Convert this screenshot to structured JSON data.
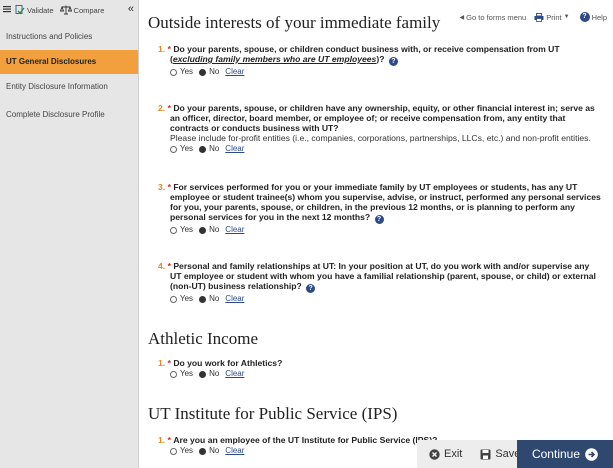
{
  "toolbar": {
    "validate_label": "Validate",
    "compare_label": "Compare",
    "collapse_glyph": "«"
  },
  "sidebar": {
    "items": [
      {
        "label": "Instructions and Policies"
      },
      {
        "label": "UT General Disclosures"
      },
      {
        "label": "Entity Disclosure Information"
      },
      {
        "label": "Complete Disclosure Profile"
      }
    ]
  },
  "header_links": {
    "back": "Go to forms menu",
    "print": "Print",
    "help": "Help"
  },
  "sections": {
    "outside": {
      "title": "Outside interests of your immediate family",
      "q1": {
        "num": "1.",
        "text_a": "Do your parents, spouse, or children conduct business with, or receive compensation from UT",
        "paren_open": "(",
        "emph": "excluding family members who are UT employees",
        "paren_close": ")?"
      },
      "q2": {
        "num": "2.",
        "text": "Do your parents, spouse, or children have any ownership, equity, or other financial interest in; serve as an officer, director, board member, or employee of; or receive compensation from, any entity that contracts or conducts business with UT?",
        "note": "Please include for-profit entities (i.e., companies, corporations, partnerships, LLCs, etc.) and non-profit entities."
      },
      "q3": {
        "num": "3.",
        "text": "For services performed for you or your immediate family by UT employees or students, has any UT employee or student trainee(s) whom you supervise, advise, or instruct, performed any personal services for you, your parents, spouse, or children, in the previous 12 months, or is planning to perform any personal services for you in the next 12 months?"
      },
      "q4": {
        "num": "4.",
        "text": "Personal and family relationships at UT: In your position at UT, do you work with and/or supervise any UT employee or student with whom you have a familial relationship (parent, spouse, or child) or external (non-UT) business relationship?"
      }
    },
    "athletic": {
      "title": "Athletic Income",
      "q1": {
        "num": "1.",
        "text": "Do you work for Athletics?"
      }
    },
    "ips": {
      "title": "UT Institute for Public Service (IPS)",
      "q1": {
        "num": "1.",
        "text": "Are you an employee of the UT Institute for Public Service (IPS)?"
      }
    }
  },
  "options": {
    "star": "*",
    "help_glyph": "?",
    "yes": "Yes",
    "no": "No",
    "clear": "Clear"
  },
  "footer": {
    "exit": "Exit",
    "save": "Save",
    "continue": "Continue"
  },
  "colors": {
    "accent_orange": "#f2a03d",
    "number_orange": "#e48a1f",
    "required_red": "#e02020",
    "link_blue": "#2c4a8a",
    "continue_bg": "#2f4870"
  }
}
